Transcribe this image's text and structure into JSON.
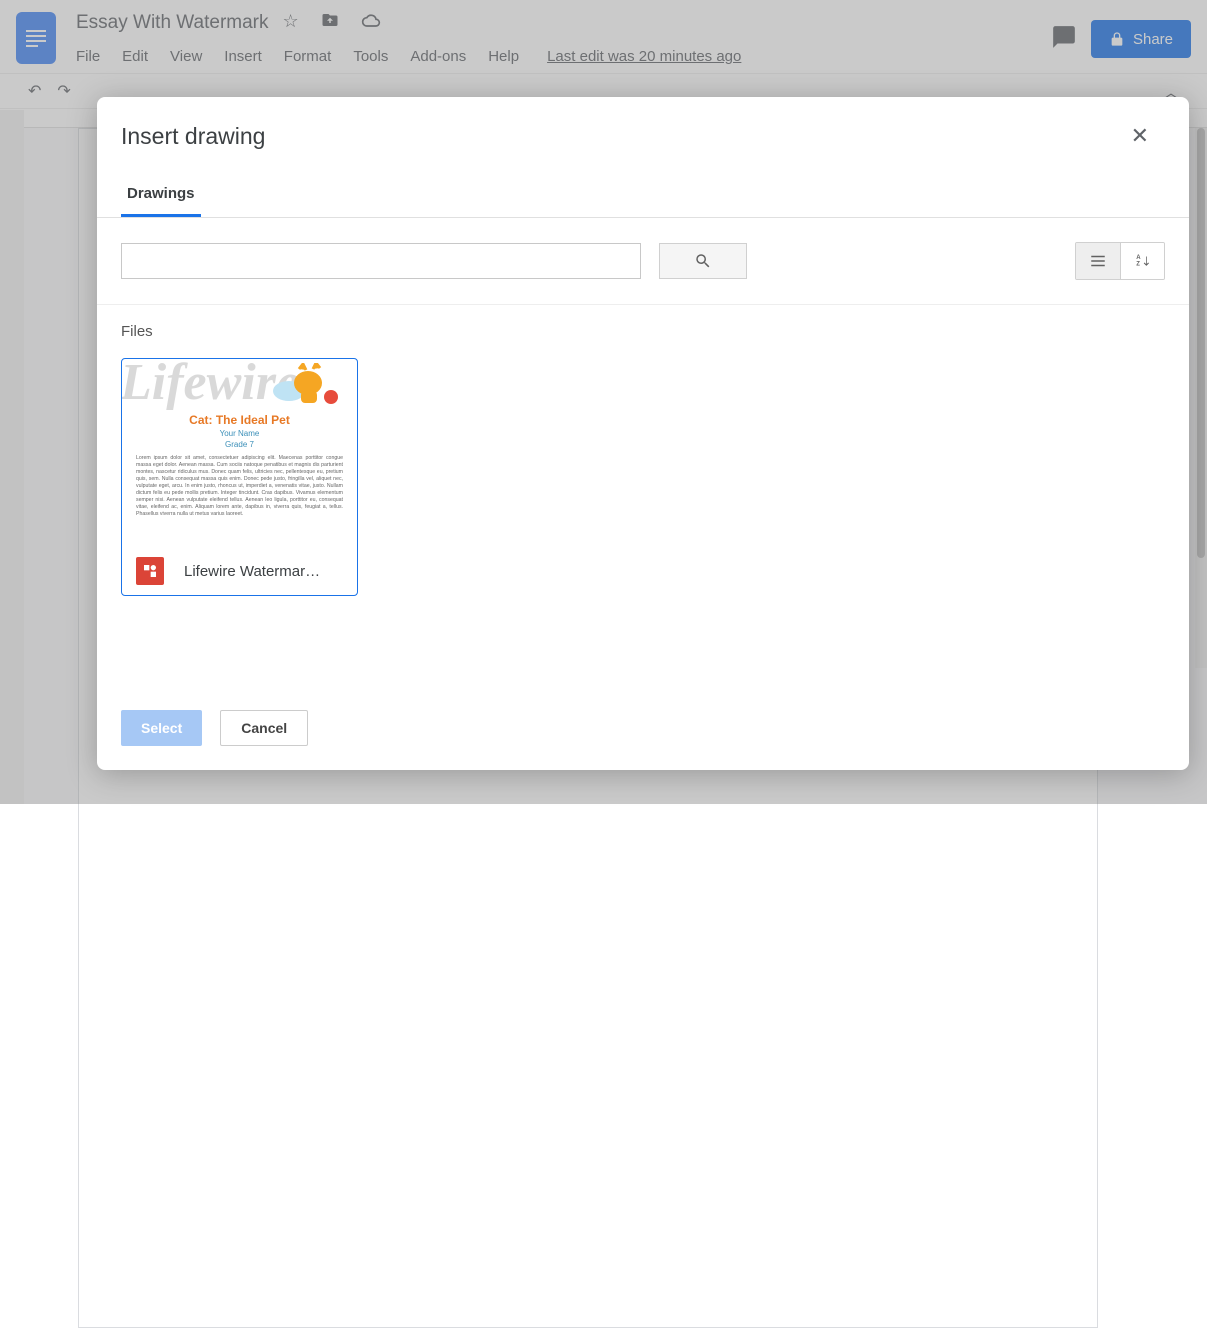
{
  "header": {
    "doc_title": "Essay With Watermark",
    "menus": [
      "File",
      "Edit",
      "View",
      "Insert",
      "Format",
      "Tools",
      "Add-ons",
      "Help"
    ],
    "last_edit": "Last edit was 20 minutes ago",
    "share_label": "Share"
  },
  "dialog": {
    "title": "Insert drawing",
    "tab_label": "Drawings",
    "files_heading": "Files",
    "file": {
      "name": "Lifewire Watermar…",
      "thumb": {
        "watermark": "Lifewire",
        "title": "Cat: The Ideal Pet",
        "name_line": "Your Name",
        "grade_line": "Grade 7",
        "body": "Lorem ipsum dolor sit amet, consectetuer adipiscing elit. Maecenas porttitor congue massa eget dolor. Aenean massa. Cum sociis natoque penatibus et magnis dis parturient montes, nascetur ridiculus mus. Donec quam felis, ultricies nec, pellentesque eu, pretium quis, sem. Nulla consequat massa quis enim. Donec pede justo, fringilla vel, aliquet nec, vulputate eget, arcu. In enim justo, rhoncus ut, imperdiet a, venenatis vitae, justo. Nullam dictum felis eu pede mollis pretium. Integer tincidunt. Cras dapibus. Vivamus elementum semper nisi. Aenean vulputate eleifend tellus. Aenean leo ligula, porttitor eu, consequat vitae, eleifend ac, enim. Aliquam lorem ante, dapibus in, viverra quis, feugiat a, tellus. Phasellus viverra nulla ut metus varius laoreet."
      }
    },
    "select_label": "Select",
    "cancel_label": "Cancel"
  }
}
